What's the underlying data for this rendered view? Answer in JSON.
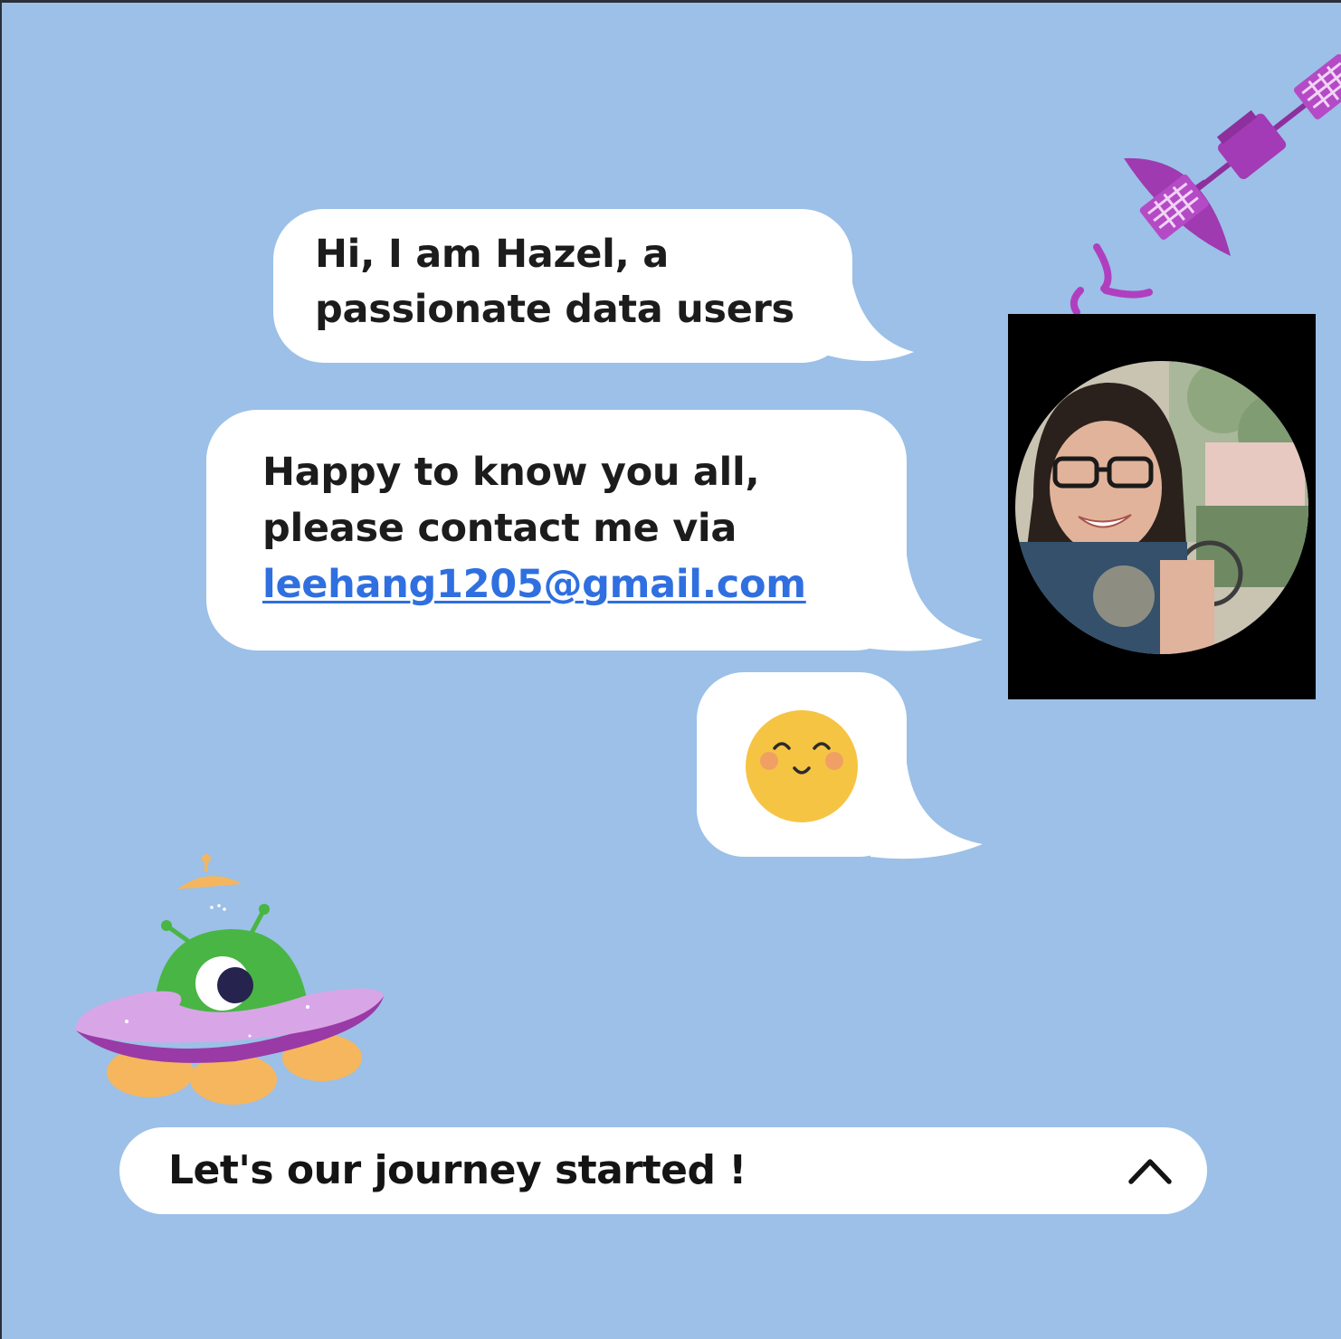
{
  "messages": {
    "greeting": {
      "line1": "Hi, I am Hazel, a",
      "line2": "passionate data users"
    },
    "contact": {
      "line1": "Happy to know you all,",
      "line2": "please contact me via",
      "email": "leehang1205@gmail.com"
    },
    "emoji": {
      "icon": "smiling-face-icon"
    }
  },
  "profile": {
    "photo": "profile-photo-of-hazel"
  },
  "cta": {
    "label": "Let's our journey started !",
    "icon": "chevron-up-icon"
  },
  "decorations": {
    "top_right": "satellite-icon",
    "bottom_left": "alien-ufo-icon"
  },
  "colors": {
    "background": "#9cc0e7",
    "bubble": "#ffffff",
    "link": "#2f6fe0",
    "satellite": "#b03fbf",
    "ufo_body": "#d8a6e6",
    "alien": "#49b544",
    "smiley": "#f6c443"
  }
}
